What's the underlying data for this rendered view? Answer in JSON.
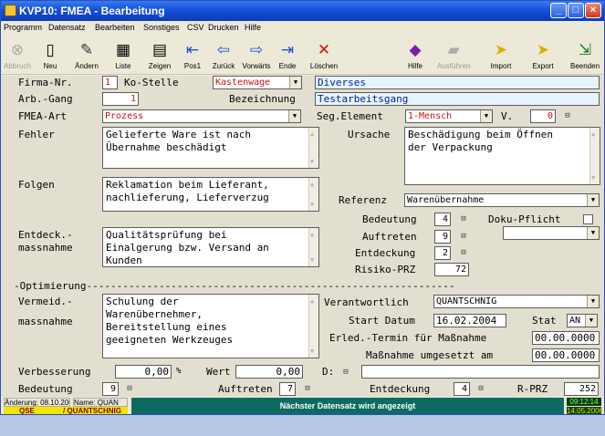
{
  "window": {
    "title": "KVP10: FMEA - Bearbeitung"
  },
  "menu": [
    "Programm",
    "Datensatz",
    "Bearbeiten",
    "Sonstiges",
    "CSV",
    "Drucken",
    "Hilfe"
  ],
  "toolbar": [
    {
      "label": "Abbruch",
      "icon": "stop-icon",
      "enabled": false
    },
    {
      "label": "Neu",
      "icon": "new-document-icon",
      "enabled": true
    },
    {
      "label": "Ändern",
      "icon": "edit-icon",
      "enabled": true
    },
    {
      "label": "Liste",
      "icon": "list-icon",
      "enabled": true
    },
    {
      "label": "Zeigen",
      "icon": "show-icon",
      "enabled": true
    },
    {
      "label": "Pos1",
      "icon": "first-icon",
      "enabled": true
    },
    {
      "label": "Zurück",
      "icon": "back-icon",
      "enabled": true
    },
    {
      "label": "Vorwärts",
      "icon": "forward-icon",
      "enabled": true
    },
    {
      "label": "Ende",
      "icon": "last-icon",
      "enabled": true
    },
    {
      "label": "Löschen",
      "icon": "delete-icon",
      "enabled": true
    },
    {
      "label": "Hilfe",
      "icon": "help-book-icon",
      "enabled": true
    },
    {
      "label": "Ausführen",
      "icon": "run-icon",
      "enabled": false
    },
    {
      "label": "Import",
      "icon": "import-icon",
      "enabled": true
    },
    {
      "label": "Export",
      "icon": "export-icon",
      "enabled": true
    },
    {
      "label": "Beenden",
      "icon": "exit-icon",
      "enabled": true
    }
  ],
  "form": {
    "firma_label": "Firma-Nr.",
    "firma": "1",
    "kostelle_label": "Ko-Stelle",
    "kostelle": "Kastenwage",
    "kostelle_desc": "Diverses",
    "arbgang_label": "Arb.-Gang",
    "arbgang": "1",
    "bezeichnung_label": "Bezeichnung",
    "bezeichnung": "Testarbeitsgang",
    "fmea_art_label": "FMEA-Art",
    "fmea_art": "Prozess",
    "seg_label": "Seg.Element",
    "seg": "1-Mensch",
    "v_label": "V.",
    "v": "0",
    "fehler_label": "Fehler",
    "fehler": "Gelieferte Ware ist nach\nÜbernahme beschädigt",
    "ursache_label": "Ursache",
    "ursache": "Beschädigung beim Öffnen\nder Verpackung",
    "folgen_label": "Folgen",
    "folgen": "Reklamation beim Lieferant,\nnachlieferung, Lieferverzug",
    "referenz_label": "Referenz",
    "referenz": "Warenübernahme",
    "bedeutung_label": "Bedeutung",
    "bedeutung": "4",
    "doku_label": "Doku-Pflicht",
    "entdeck_label1": "Entdeck.-",
    "entdeck_label2": "massnahme",
    "entdeck": "Qualitätsprüfung bei\nEinalgerung bzw. Versand an\nKunden",
    "auftreten_label": "Auftreten",
    "auftreten": "9",
    "entdeckung_label": "Entdeckung",
    "entdeckung": "2",
    "risiko_label": "Risiko-PRZ",
    "risiko": "72",
    "opt_label": "-Optimierung-------------------------------------------------------------",
    "vermeid_label1": "Vermeid.-",
    "vermeid_label2": "massnahme",
    "vermeid": "Schulung der\nWarenübernehmer,\nBereitstellung eines\ngeeigneten Werkzeuges",
    "verantw_label": "Verantwortlich",
    "verantw": "QUANTSCHNIG",
    "start_label": "Start Datum",
    "start": "16.02.2004",
    "stat_label": "Stat",
    "stat": "AN",
    "erled_label": "Erled.-Termin für Maßnahme",
    "erled": "00.00.0000",
    "umges_label": "Maßnahme umgesetzt am",
    "umges": "00.00.0000",
    "verb_label": "Verbesserung",
    "verb": "0,00",
    "pct": "%",
    "wert_label": "Wert",
    "wert": "0,00",
    "d_label": "D:",
    "bed2_label": "Bedeutung",
    "bed2": "9",
    "auf2_label": "Auftreten",
    "auf2": "7",
    "ent2_label": "Entdeckung",
    "ent2": "4",
    "rprz_label": "R-PRZ",
    "rprz": "252"
  },
  "status": {
    "aenderung": "Änderung: 08.10.2004",
    "name": "Name: QUAN",
    "dept": "QSE",
    "user": "/ QUANTSCHNIG",
    "message": "Nächster Datensatz wird angezeigt",
    "time": "09:12:14",
    "date": "14.05.2006"
  },
  "colors": {
    "title": "#1450d8",
    "status_msg": "#0c6b62",
    "clock": "#0a3d0a",
    "yellow": "#f2e600",
    "red_text": "#d01010",
    "blue_text": "#00229a"
  }
}
